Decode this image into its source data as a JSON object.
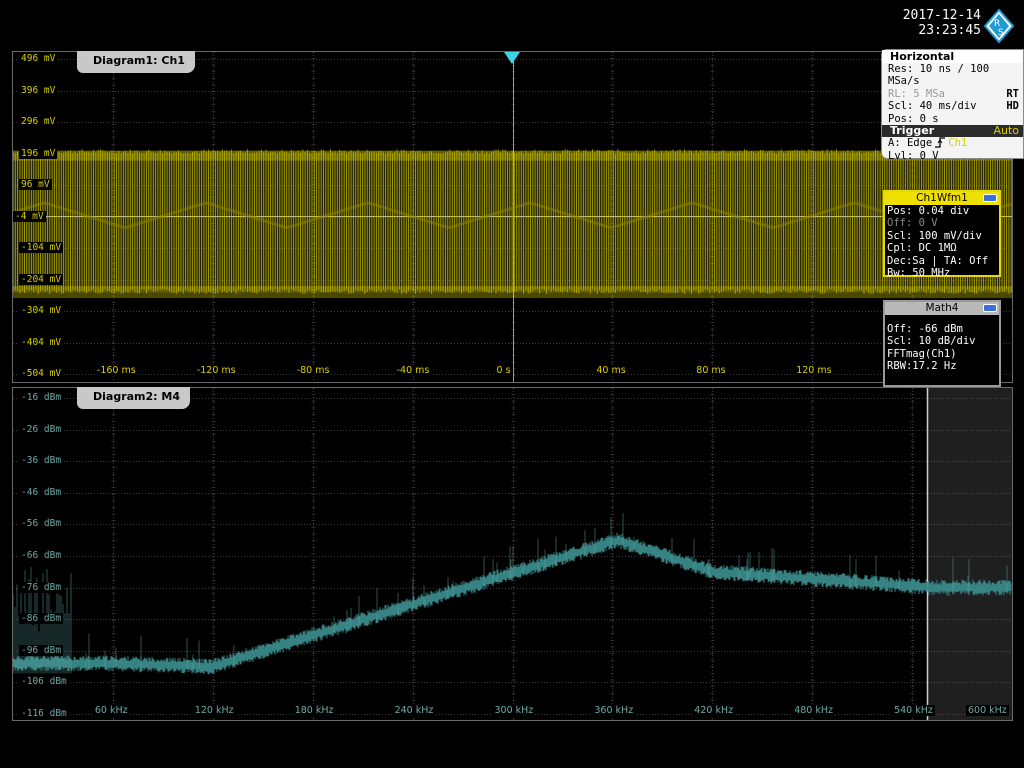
{
  "datetime": {
    "date": "2017-12-14",
    "time": "23:23:45"
  },
  "brand_icon": "rohde-schwarz-logo",
  "trigger_marker_icon": "trigger-position-marker",
  "diagram1": {
    "title": "Diagram1: Ch1",
    "trace_color": "#d4cc00",
    "y_labels": [
      "496 mV",
      "396 mV",
      "296 mV",
      "196 mV",
      "96 mV",
      "-4 mV",
      "-104 mV",
      "-204 mV",
      "-304 mV",
      "-404 mV",
      "-504 mV"
    ],
    "x_labels": [
      "-160 ms",
      "-120 ms",
      "-80 ms",
      "-40 ms",
      "0 s",
      "40 ms",
      "80 ms",
      "120 ms"
    ]
  },
  "diagram2": {
    "title": "Diagram2: M4",
    "trace_color": "#3a8a8a",
    "y_labels": [
      "-16 dBm",
      "-26 dBm",
      "-36 dBm",
      "-46 dBm",
      "-56 dBm",
      "-66 dBm",
      "-76 dBm",
      "-86 dBm",
      "-96 dBm",
      "-106 dBm",
      "-116 dBm"
    ],
    "x_labels": [
      "60 kHz",
      "120 kHz",
      "180 kHz",
      "240 kHz",
      "300 kHz",
      "360 kHz",
      "420 kHz",
      "480 kHz",
      "540 kHz",
      "600 kHz"
    ]
  },
  "horizontal_panel": {
    "title": "Horizontal",
    "res": "Res: 10 ns / 100 MSa/s",
    "rl": "RL:  5 MSa",
    "rl_badge": "RT",
    "scl": "Scl: 40 ms/div",
    "scl_badge": "HD",
    "pos": "Pos: 0 s",
    "trigger_title": "Trigger",
    "trigger_mode": "Auto",
    "trig_source_prefix": "A:  Edge",
    "trig_source": "Ch1",
    "trig_level": "Lvl: 0 V"
  },
  "ch1_panel": {
    "title": "Ch1Wfm1",
    "lines": [
      "Pos: 0.04 div",
      "Off: 0 V",
      "Scl: 100 mV/div",
      "Cpl: DC 1MΩ",
      "Dec:Sa | TA: Off",
      "Bw: 50 MHz"
    ]
  },
  "math_panel": {
    "title": "Math4",
    "lines": [
      "",
      "Off:  -66 dBm",
      "Scl:  10 dB/div",
      "FFTmag(Ch1)",
      "RBW:17.2 Hz"
    ]
  }
}
